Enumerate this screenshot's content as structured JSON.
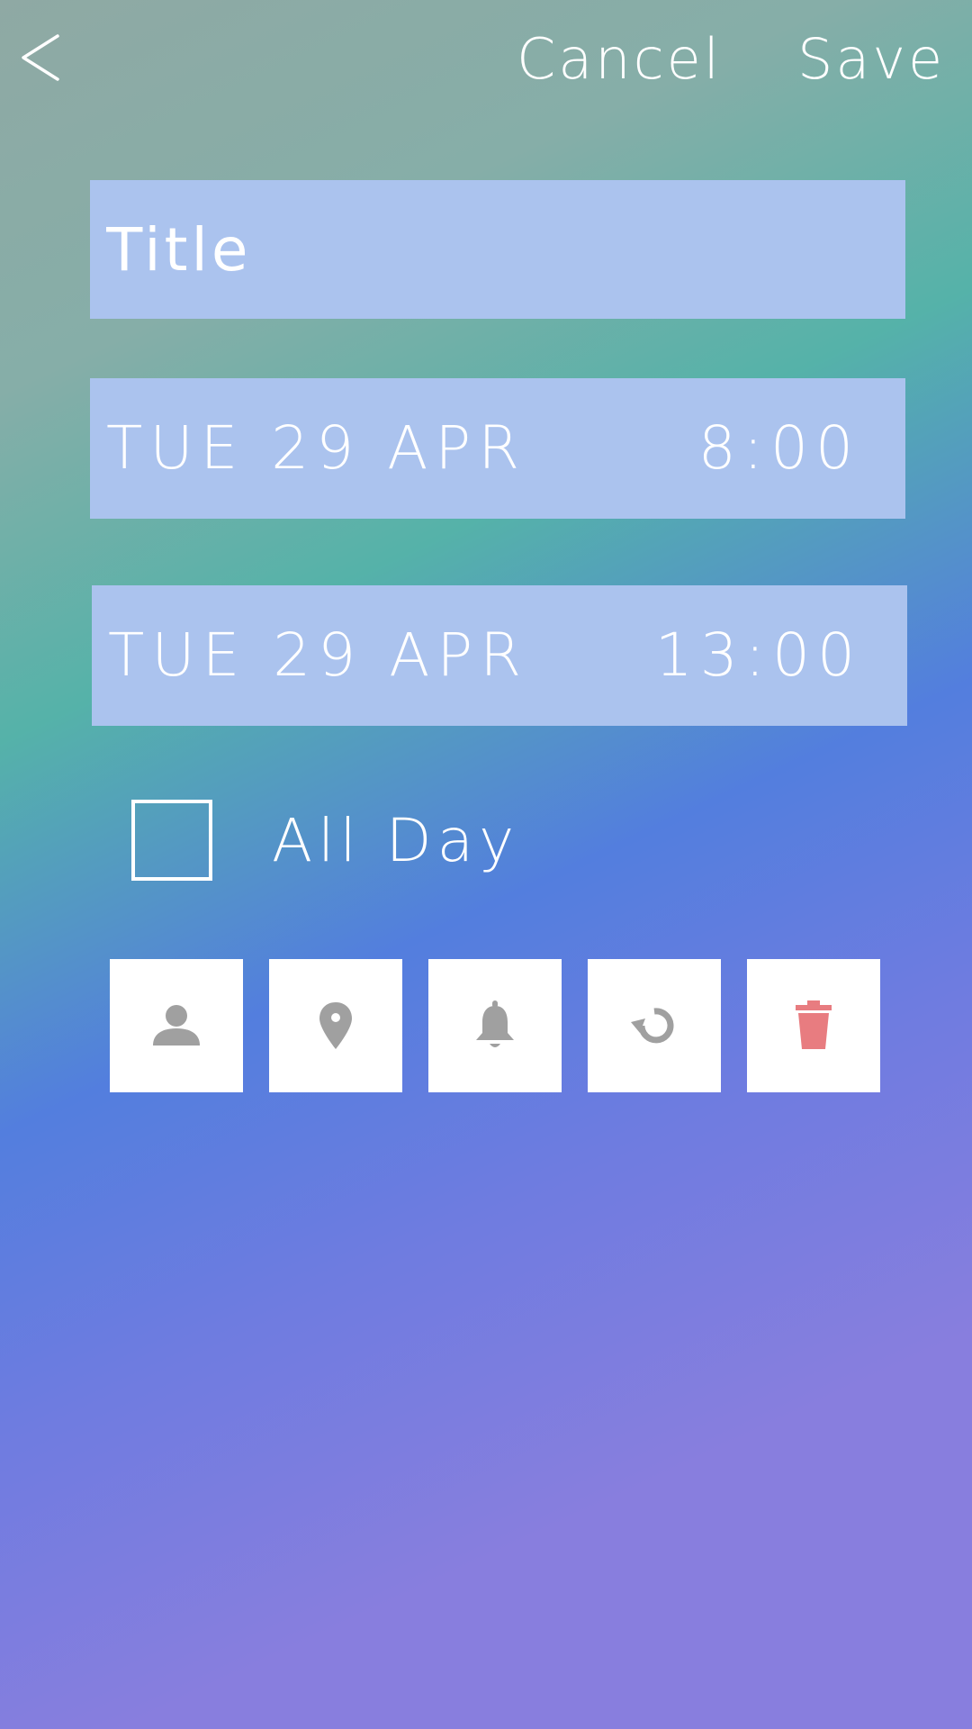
{
  "header": {
    "back_label": "<",
    "cancel_label": "Cancel",
    "save_label": "Save"
  },
  "form": {
    "title_placeholder": "Title",
    "title_value": "",
    "start": {
      "date": "TUE 29 APR",
      "time": "8:00"
    },
    "end": {
      "date": "TUE 29 APR",
      "time": "13:00"
    },
    "all_day": {
      "label": "All Day",
      "checked": false
    }
  },
  "tools": [
    {
      "icon": "person-icon",
      "purpose": "contact"
    },
    {
      "icon": "location-pin-icon",
      "purpose": "location"
    },
    {
      "icon": "bell-icon",
      "purpose": "alarm"
    },
    {
      "icon": "repeat-icon",
      "purpose": "repeat"
    },
    {
      "icon": "trash-icon",
      "purpose": "delete"
    }
  ],
  "colors": {
    "field_background": "#abc3ee",
    "icon_gray": "#a0a0a0",
    "delete_red": "#e87c80",
    "gradient_teal": "#55b2a9",
    "gradient_blue": "#537ede",
    "gradient_purple": "#887ede"
  }
}
